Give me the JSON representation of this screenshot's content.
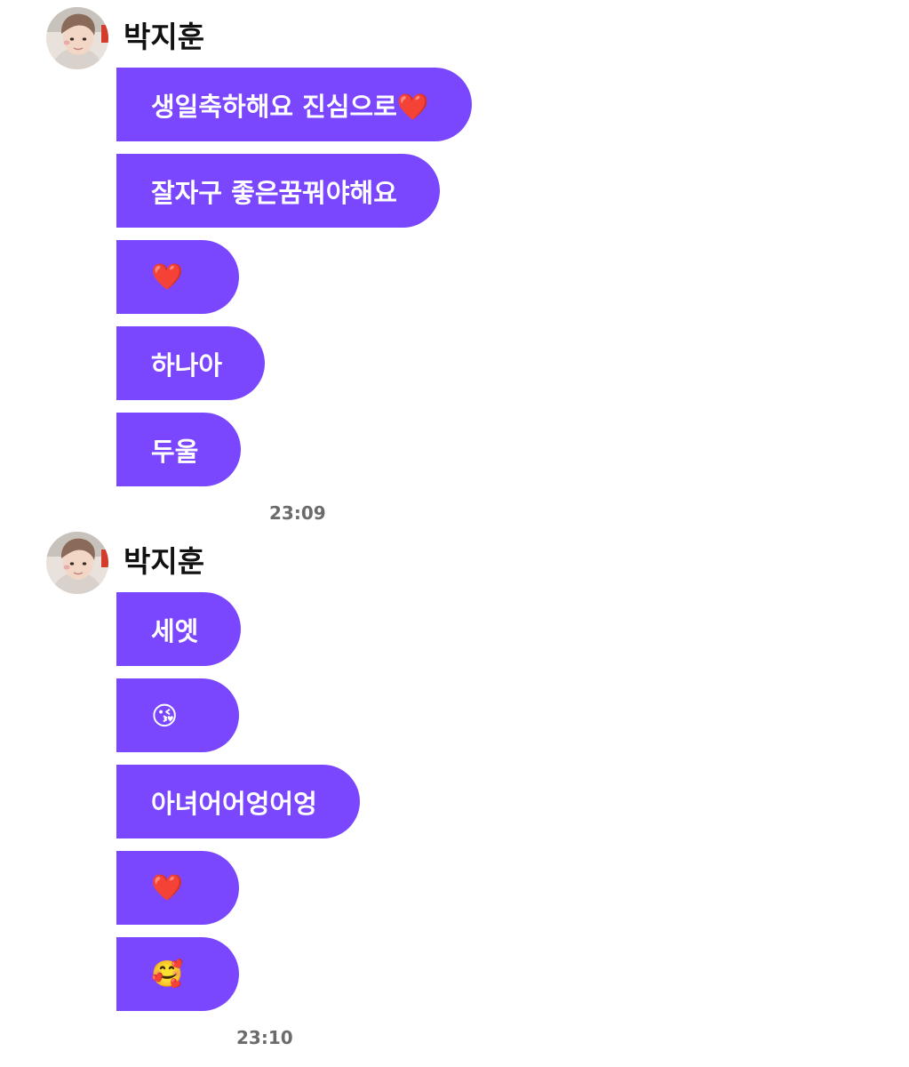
{
  "conversation": {
    "groups": [
      {
        "sender": "박지훈",
        "messages": [
          "생일축하해요 진심으로❤️",
          "잘자구 좋은꿈꿔야해요",
          "❤️",
          "하나아",
          "두울"
        ],
        "time": "23:09"
      },
      {
        "sender": "박지훈",
        "messages": [
          "세엣",
          "😘",
          "아녀어어엉어엉",
          "❤️",
          "🥰"
        ],
        "time": "23:10"
      }
    ]
  },
  "colors": {
    "bubble": "#7a47ff",
    "bubble_text": "#ffffff",
    "timestamp": "#6b6b6b",
    "name": "#111111",
    "background": "#ffffff"
  },
  "icons": {
    "avatar": "profile-photo"
  }
}
